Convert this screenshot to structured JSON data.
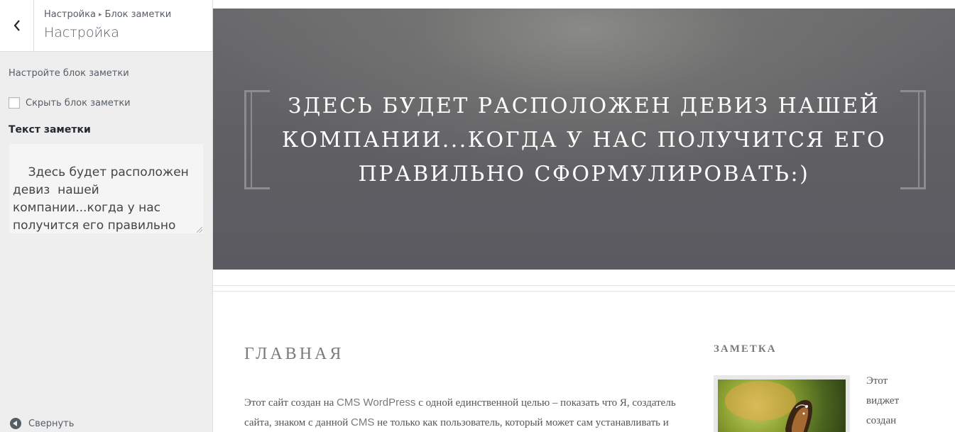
{
  "sidebar": {
    "breadcrumb": {
      "parent": "Настройка",
      "separator": "▸",
      "current": "Блок заметки"
    },
    "title": "Настройка",
    "description": "Настройте блок заметки",
    "hide_checkbox": {
      "label": "Скрыть блок заметки",
      "checked": false
    },
    "textarea": {
      "label": "Текст заметки",
      "value": "Здесь будет расположен девиз  нашей компании...когда у нас получится его правильно сформулировать:)"
    },
    "collapse_label": "Свернуть"
  },
  "preview": {
    "hero_motto": "Здесь будет расположен девиз нашей компании...когда у нас получится его правильно сформулировать:)",
    "page_title": "Главная",
    "body": {
      "p1_a": "Этот сайт создан на ",
      "p1_link": "CMS WordPress",
      "p1_b": " с одной единственной целью – показать что Я, создатель сайта, знаком с данной ",
      "p1_link2": "CMS",
      "p1_c": " не только как пользователь, который может сам устанавливать и"
    },
    "widget": {
      "title": "Заметка",
      "text": "Этот виджет создан"
    }
  },
  "colors": {
    "hero_bg": "#5e5e63",
    "sidebar_bg": "#eeeeee",
    "text_muted": "#555d66"
  }
}
